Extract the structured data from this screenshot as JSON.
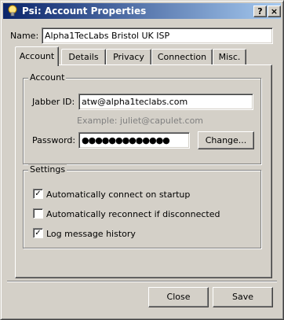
{
  "window": {
    "title": "Psi: Account Properties",
    "help_glyph": "?",
    "close_glyph": "×"
  },
  "name_field": {
    "label": "Name:",
    "value": "Alpha1TecLabs Bristol UK ISP"
  },
  "tabs": [
    {
      "label": "Account",
      "active": true
    },
    {
      "label": "Details"
    },
    {
      "label": "Privacy"
    },
    {
      "label": "Connection"
    },
    {
      "label": "Misc."
    }
  ],
  "account_group": {
    "title": "Account",
    "jid_label": "Jabber ID:",
    "jid_value": "atw@alpha1teclabs.com",
    "example": "Example: juliet@capulet.com",
    "password_label": "Password:",
    "password_value": "●●●●●●●●●●●●●",
    "change_button": "Change..."
  },
  "settings_group": {
    "title": "Settings",
    "options": [
      {
        "label": "Automatically connect on startup",
        "checked": true,
        "mark": "✓"
      },
      {
        "label": "Automatically reconnect if disconnected",
        "checked": false,
        "mark": ""
      },
      {
        "label": "Log message history",
        "checked": true,
        "mark": "✓"
      }
    ]
  },
  "footer": {
    "close_button": "Close",
    "save_button": "Save"
  }
}
